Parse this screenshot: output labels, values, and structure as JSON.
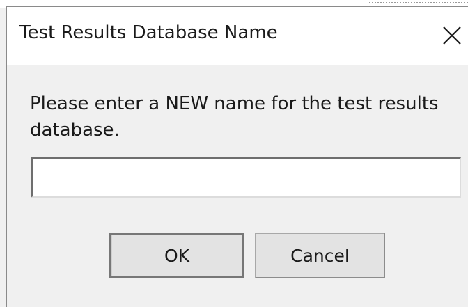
{
  "window": {
    "title": "Test Results Database Name",
    "close_icon": "close-icon"
  },
  "prompt": {
    "text": "Please enter a NEW name for the test results database."
  },
  "name_input": {
    "value": "",
    "placeholder": ""
  },
  "buttons": {
    "ok_label": "OK",
    "cancel_label": "Cancel"
  }
}
